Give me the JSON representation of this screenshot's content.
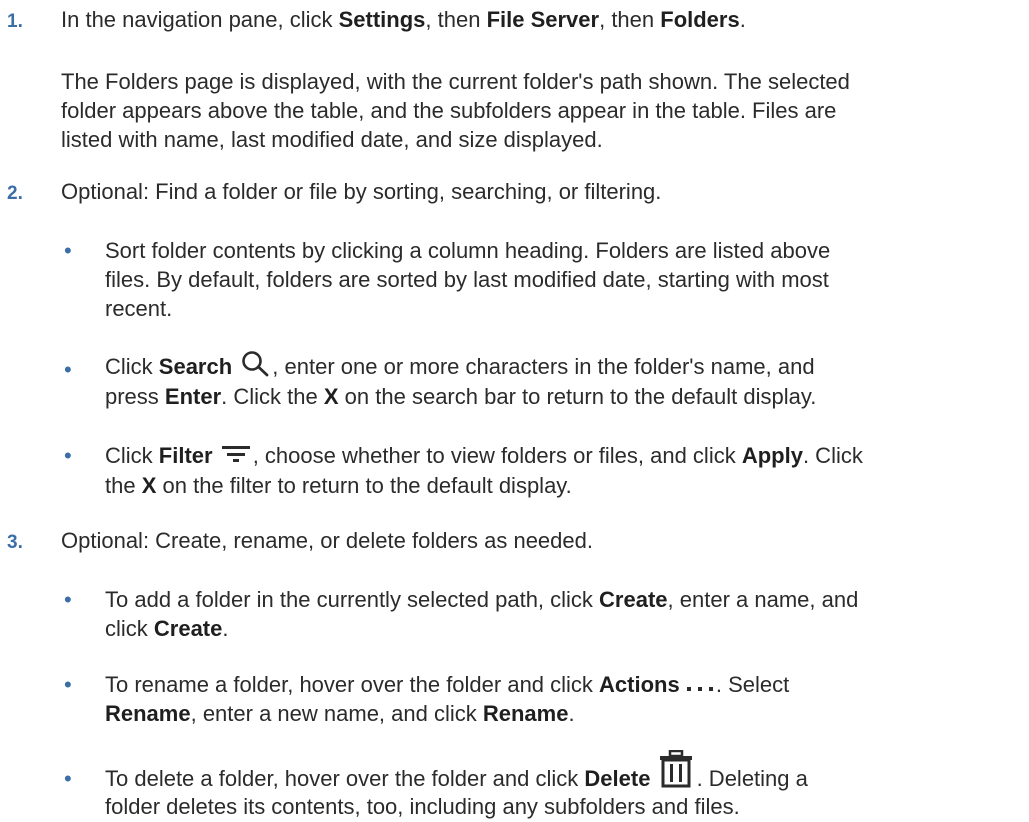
{
  "steps": [
    {
      "number": "1.",
      "s1_a": "In the navigation pane, click ",
      "s1_settings": "Settings",
      "s1_b": ", then ",
      "s1_fileserver": "File Server",
      "s1_c": ", then ",
      "s1_folders": "Folders",
      "s1_d": ".",
      "para_l1": "The Folders page is displayed, with the current folder's path shown. The selected",
      "para_l2": "folder appears above the table, and the subfolders appear in the table. Files are",
      "para_l3": "listed with name, last modified date, and size displayed."
    },
    {
      "number": "2.",
      "text": "Optional: Find a folder or file by sorting, searching, or filtering.",
      "b1_l1": "Sort folder contents by clicking a column heading. Folders are listed above",
      "b1_l2": "files. By default, folders are sorted by last modified date, starting with most",
      "b1_l3": "recent.",
      "b2_a": "Click ",
      "b2_search": "Search",
      "b2_b": ", enter one or more characters in the folder's name, and",
      "b2_c": "press ",
      "b2_enter": "Enter",
      "b2_d": ". Click the ",
      "b2_x": "X",
      "b2_e": " on the search bar to return to the default display.",
      "b3_a": "Click ",
      "b3_filter": "Filter",
      "b3_b": ", choose whether to view folders or files, and click ",
      "b3_apply": "Apply",
      "b3_c": ". Click",
      "b3_d": "the ",
      "b3_x": "X",
      "b3_e": " on the filter to return to the default display."
    },
    {
      "number": "3.",
      "text": "Optional: Create, rename, or delete folders as needed.",
      "c1_a": "To add a folder in the currently selected path, click ",
      "c1_create": "Create",
      "c1_b": ", enter a name, and",
      "c1_c": "click ",
      "c1_create2": "Create",
      "c1_d": ".",
      "c2_a": "To rename a folder, hover over the folder and click ",
      "c2_actions": "Actions",
      "c2_b": ". Select",
      "c2_rename": "Rename",
      "c2_c": ", enter a new name, and click ",
      "c2_rename2": "Rename",
      "c2_d": ".",
      "c3_a": "To delete a folder, hover over the folder and click ",
      "c3_delete": "Delete",
      "c3_b": ". Deleting a",
      "c3_l2": "folder deletes its contents, too, including any subfolders and files."
    }
  ],
  "bullet_char": "•",
  "icons": {
    "search": "search-icon",
    "filter": "filter-icon",
    "actions": "ellipsis-icon",
    "delete": "trash-icon"
  },
  "colors": {
    "accent": "#3a6ea5",
    "text": "#2b2b2b"
  }
}
